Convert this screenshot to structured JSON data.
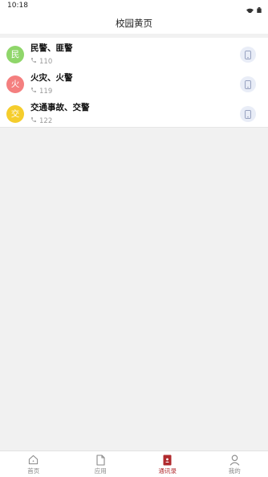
{
  "status_bar": {
    "time": "10:18",
    "icons": [
      "wifi-icon",
      "battery-icon"
    ]
  },
  "header": {
    "title": "校园黄页"
  },
  "contacts": [
    {
      "avatar_char": "民",
      "avatar_color": "#8fd66a",
      "name": "民警、匪警",
      "phone": "110"
    },
    {
      "avatar_char": "火",
      "avatar_color": "#f47f7f",
      "name": "火灾、火警",
      "phone": "119"
    },
    {
      "avatar_char": "交",
      "avatar_color": "#f5cd2c",
      "name": "交通事故、交警",
      "phone": "122"
    }
  ],
  "tab_bar": {
    "tabs": [
      {
        "label": "首页",
        "icon": "home-icon",
        "active": false
      },
      {
        "label": "应用",
        "icon": "document-icon",
        "active": false
      },
      {
        "label": "通讯录",
        "icon": "contacts-book-icon",
        "active": true
      },
      {
        "label": "我的",
        "icon": "person-icon",
        "active": false
      }
    ]
  },
  "colors": {
    "accent": "#b02a2e",
    "background": "#f1f1f1",
    "call_button_bg": "#e9edf7"
  }
}
